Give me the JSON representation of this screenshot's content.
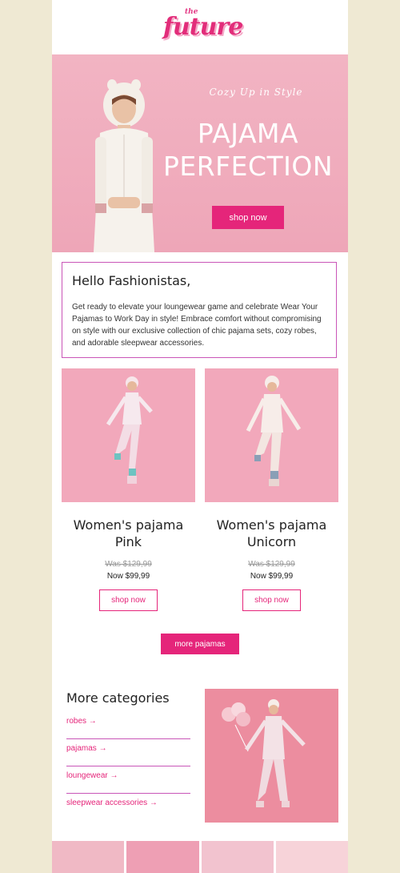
{
  "brand": {
    "the": "the",
    "name": "future"
  },
  "hero": {
    "tagline": "Cozy Up in Style",
    "title_line1": "PAJAMA",
    "title_line2": "PERFECTION",
    "cta": "shop now"
  },
  "intro": {
    "heading": "Hello Fashionistas,",
    "body": "Get ready to elevate your loungewear game and celebrate Wear Your Pajamas to Work Day in style! Embrace comfort without compromising on style with our exclusive collection of chic pajama sets, cozy robes, and adorable sleepwear accessories."
  },
  "products": [
    {
      "name": "Women's pajama Pink",
      "was": "Was $129,99",
      "now": "Now $99,99",
      "cta": "shop now"
    },
    {
      "name": "Women's pajama Unicorn",
      "was": "Was $129,99",
      "now": "Now $99,99",
      "cta": "shop now"
    }
  ],
  "more_button": "more pajamas",
  "categories": {
    "heading": "More categories",
    "items": [
      "robes →",
      "pajamas →",
      "loungewear →",
      "sleepwear accessories →"
    ]
  },
  "colors": {
    "accent": "#e5257a",
    "hero_bg": "#f2b4c3",
    "page_bg": "#efe9d3",
    "border": "#c956b8"
  }
}
